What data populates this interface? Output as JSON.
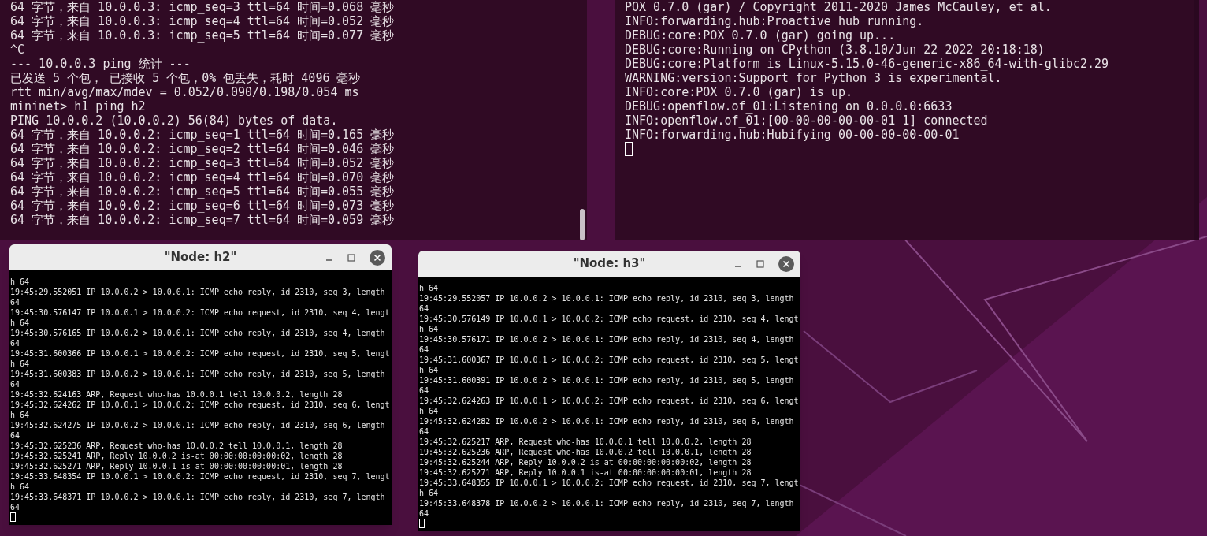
{
  "main_terminals": [
    {
      "lines": [
        "64 字节，来自 10.0.0.3: icmp_seq=3 ttl=64 时间=0.068 毫秒",
        "64 字节，来自 10.0.0.3: icmp_seq=4 ttl=64 时间=0.052 毫秒",
        "64 字节，来自 10.0.0.3: icmp_seq=5 ttl=64 时间=0.077 毫秒",
        "^C",
        "--- 10.0.0.3 ping 统计 ---",
        "已发送 5 个包， 已接收 5 个包，0% 包丢失，耗时 4096 毫秒",
        "rtt min/avg/max/mdev = 0.052/0.090/0.198/0.054 ms",
        "mininet> h1 ping h2",
        "PING 10.0.0.2 (10.0.0.2) 56(84) bytes of data.",
        "64 字节，来自 10.0.0.2: icmp_seq=1 ttl=64 时间=0.165 毫秒",
        "64 字节，来自 10.0.0.2: icmp_seq=2 ttl=64 时间=0.046 毫秒",
        "64 字节，来自 10.0.0.2: icmp_seq=3 ttl=64 时间=0.052 毫秒",
        "64 字节，来自 10.0.0.2: icmp_seq=4 ttl=64 时间=0.070 毫秒",
        "64 字节，来自 10.0.0.2: icmp_seq=5 ttl=64 时间=0.055 毫秒",
        "64 字节，来自 10.0.0.2: icmp_seq=6 ttl=64 时间=0.073 毫秒",
        "64 字节，来自 10.0.0.2: icmp_seq=7 ttl=64 时间=0.059 毫秒"
      ]
    },
    {
      "lines": [
        "POX 0.7.0 (gar) / Copyright 2011-2020 James McCauley, et al.",
        "INFO:forwarding.hub:Proactive hub running.",
        "DEBUG:core:POX 0.7.0 (gar) going up...",
        "DEBUG:core:Running on CPython (3.8.10/Jun 22 2022 20:18:18)",
        "DEBUG:core:Platform is Linux-5.15.0-46-generic-x86_64-with-glibc2.29",
        "WARNING:version:Support for Python 3 is experimental.",
        "INFO:core:POX 0.7.0 (gar) is up.",
        "DEBUG:openflow.of_01:Listening on 0.0.0.0:6633",
        "INFO:openflow.of_01:[00-00-00-00-00-01 1] connected",
        "INFO:forwarding.hub:Hubifying 00-00-00-00-00-01"
      ]
    }
  ],
  "node_windows": [
    {
      "title": "\"Node: h2\"",
      "lines": [
        "h 64",
        "19:45:29.552051 IP 10.0.0.2 > 10.0.0.1: ICMP echo reply, id 2310, seq 3, length",
        "64",
        "19:45:30.576147 IP 10.0.0.1 > 10.0.0.2: ICMP echo request, id 2310, seq 4, lengt",
        "h 64",
        "19:45:30.576165 IP 10.0.0.2 > 10.0.0.1: ICMP echo reply, id 2310, seq 4, length",
        "64",
        "19:45:31.600366 IP 10.0.0.1 > 10.0.0.2: ICMP echo request, id 2310, seq 5, lengt",
        "h 64",
        "19:45:31.600383 IP 10.0.0.2 > 10.0.0.1: ICMP echo reply, id 2310, seq 5, length",
        "64",
        "19:45:32.624163 ARP, Request who-has 10.0.0.1 tell 10.0.0.2, length 28",
        "19:45:32.624262 IP 10.0.0.1 > 10.0.0.2: ICMP echo request, id 2310, seq 6, lengt",
        "h 64",
        "19:45:32.624275 IP 10.0.0.2 > 10.0.0.1: ICMP echo reply, id 2310, seq 6, length",
        "64",
        "19:45:32.625236 ARP, Request who-has 10.0.0.2 tell 10.0.0.1, length 28",
        "19:45:32.625241 ARP, Reply 10.0.0.2 is-at 00:00:00:00:00:02, length 28",
        "19:45:32.625271 ARP, Reply 10.0.0.1 is-at 00:00:00:00:00:01, length 28",
        "19:45:33.648354 IP 10.0.0.1 > 10.0.0.2: ICMP echo request, id 2310, seq 7, lengt",
        "h 64",
        "19:45:33.648371 IP 10.0.0.2 > 10.0.0.1: ICMP echo reply, id 2310, seq 7, length",
        "64"
      ]
    },
    {
      "title": "\"Node: h3\"",
      "lines": [
        "h 64",
        "19:45:29.552057 IP 10.0.0.2 > 10.0.0.1: ICMP echo reply, id 2310, seq 3, length",
        "64",
        "19:45:30.576149 IP 10.0.0.1 > 10.0.0.2: ICMP echo request, id 2310, seq 4, lengt",
        "h 64",
        "19:45:30.576171 IP 10.0.0.2 > 10.0.0.1: ICMP echo reply, id 2310, seq 4, length",
        "64",
        "19:45:31.600367 IP 10.0.0.1 > 10.0.0.2: ICMP echo request, id 2310, seq 5, lengt",
        "h 64",
        "19:45:31.600391 IP 10.0.0.2 > 10.0.0.1: ICMP echo reply, id 2310, seq 5, length",
        "64",
        "19:45:32.624263 IP 10.0.0.1 > 10.0.0.2: ICMP echo request, id 2310, seq 6, lengt",
        "h 64",
        "19:45:32.624282 IP 10.0.0.2 > 10.0.0.1: ICMP echo reply, id 2310, seq 6, length",
        "64",
        "19:45:32.625217 ARP, Request who-has 10.0.0.1 tell 10.0.0.2, length 28",
        "19:45:32.625236 ARP, Request who-has 10.0.0.2 tell 10.0.0.1, length 28",
        "19:45:32.625244 ARP, Reply 10.0.0.2 is-at 00:00:00:00:00:02, length 28",
        "19:45:32.625271 ARP, Reply 10.0.0.1 is-at 00:00:00:00:00:01, length 28",
        "19:45:33.648355 IP 10.0.0.1 > 10.0.0.2: ICMP echo request, id 2310, seq 7, lengt",
        "h 64",
        "19:45:33.648378 IP 10.0.0.2 > 10.0.0.1: ICMP echo reply, id 2310, seq 7, length",
        "64"
      ]
    }
  ]
}
